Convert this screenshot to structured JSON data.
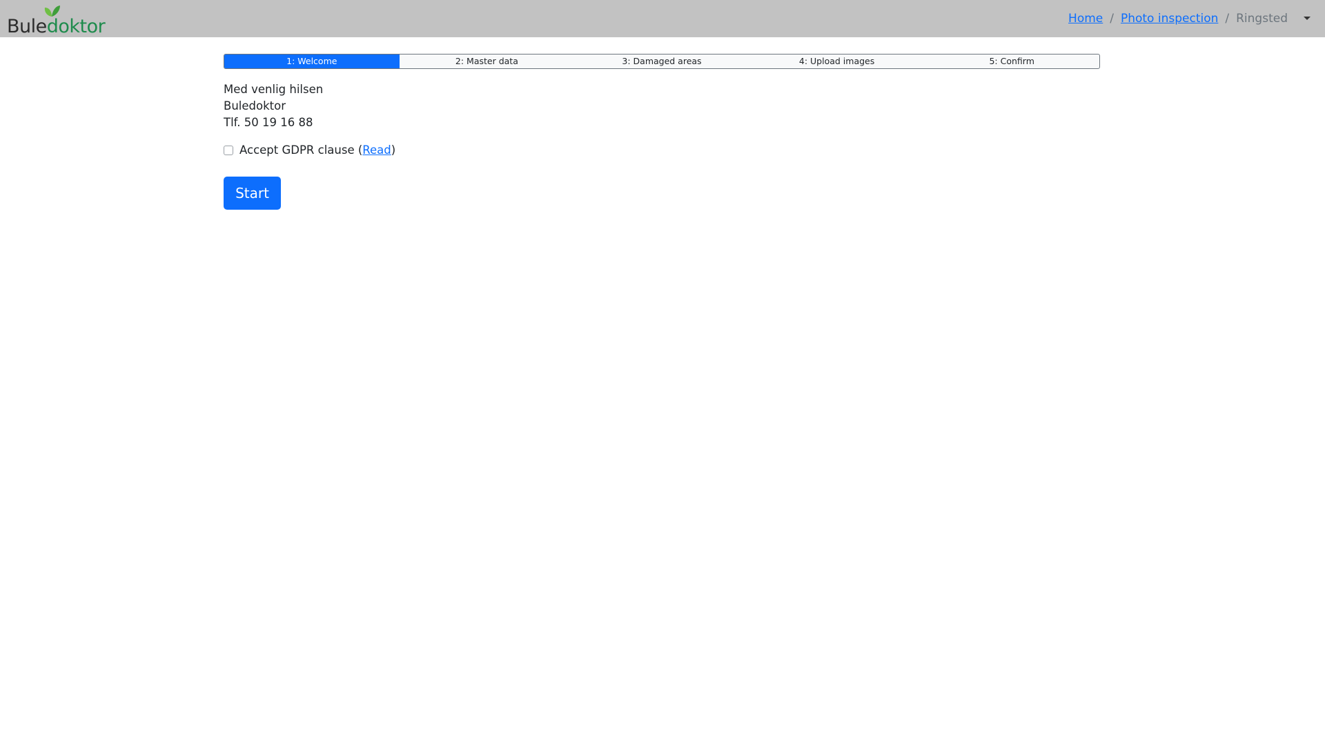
{
  "header": {
    "logo": {
      "text_part1": "Bule",
      "text_part2": "doktor",
      "icon": "leaf-icon",
      "colors": {
        "dark": "#2b2b2b",
        "green": "#1e8b4c"
      }
    },
    "breadcrumb": {
      "items": [
        {
          "label": "Home"
        },
        {
          "label": "Photo inspection"
        }
      ],
      "separator": "/",
      "current": "Ringsted"
    },
    "menu_toggle_icon": "caret-down-icon",
    "background": "#c2c2c2"
  },
  "steps": {
    "active_index": 0,
    "items": [
      {
        "label": "1: Welcome"
      },
      {
        "label": "2: Master data"
      },
      {
        "label": "3: Damaged areas"
      },
      {
        "label": "4: Upload images"
      },
      {
        "label": "5: Confirm"
      }
    ],
    "accent": "#0d6efd"
  },
  "content": {
    "lines": [
      "Med venlig hilsen",
      "Buledoktor",
      "Tlf. 50 19 16 88"
    ]
  },
  "gdpr": {
    "checked": false,
    "label": "Accept GDPR clause (",
    "link": "Read",
    "suffix": ")"
  },
  "start_button": {
    "label": "Start"
  }
}
